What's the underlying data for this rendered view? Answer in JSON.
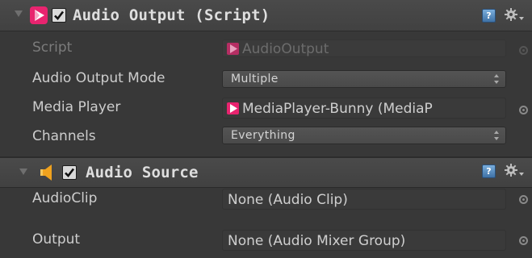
{
  "audio_output": {
    "title": "Audio Output (Script)",
    "help_icon_text": "?",
    "rows": [
      {
        "label": "Script",
        "value": "AudioOutput"
      },
      {
        "label": "Audio Output Mode",
        "value": "Multiple"
      },
      {
        "label": "Media Player",
        "value": "MediaPlayer-Bunny (MediaP"
      },
      {
        "label": "Channels",
        "value": "Everything"
      }
    ]
  },
  "audio_source": {
    "title": "Audio Source",
    "help_icon_text": "?",
    "rows": [
      {
        "label": "AudioClip",
        "value": "None (Audio Clip)"
      },
      {
        "label": "Output",
        "value": "None (Audio Mixer Group)"
      }
    ]
  },
  "colors": {
    "panel_bg": "#383838",
    "header_bg": "#444444",
    "accent_pink": "#e8246f",
    "speaker_orange": "#f0a21e",
    "help_blue": "#4a86c0"
  },
  "icons": {
    "foldout": "triangle-down-icon",
    "audio_output_component": "avpro-media-icon",
    "audio_source_component": "speaker-icon",
    "help": "help-icon",
    "settings": "gear-icon",
    "object_picker": "object-picker-icon",
    "popup_arrows": "updown-arrows-icon"
  }
}
